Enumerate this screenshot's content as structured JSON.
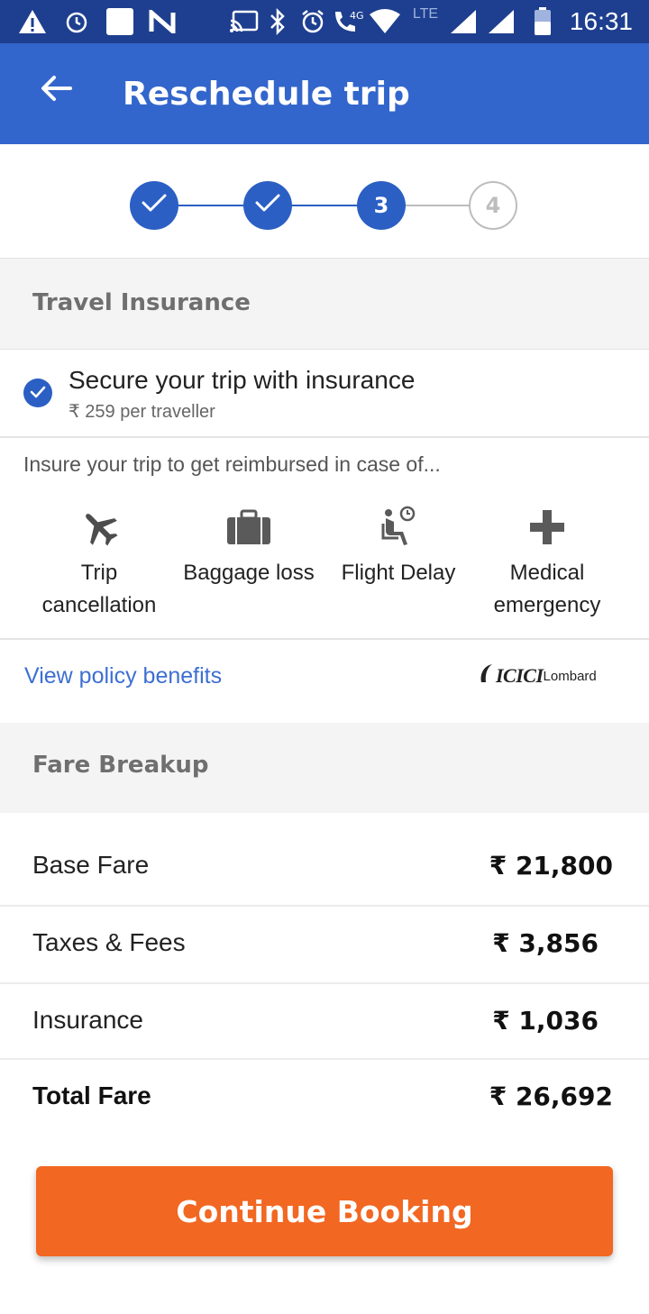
{
  "status_bar": {
    "time": "16:31",
    "network_label": "LTE",
    "data_label": "4G",
    "icons": [
      "alert-icon",
      "alarm-icon",
      "notification-icon",
      "n-icon",
      "cast-icon",
      "bluetooth-icon",
      "alarm-icon",
      "volte-icon",
      "wifi-icon",
      "signal-icon",
      "signal-icon",
      "battery-icon"
    ]
  },
  "app_bar": {
    "title": "Reschedule trip",
    "back_icon": "arrow-back-icon",
    "color": "#3366cc"
  },
  "stepper": {
    "steps": [
      {
        "label": "",
        "state": "done"
      },
      {
        "label": "",
        "state": "done"
      },
      {
        "label": "3",
        "state": "current"
      },
      {
        "label": "4",
        "state": "todo"
      }
    ]
  },
  "insurance": {
    "section_title": "Travel Insurance",
    "option_title": "Secure your trip with insurance",
    "option_price": "₹ 259 per traveller",
    "checked": true,
    "description": "Insure your trip to get reimbursed in case of...",
    "benefits": [
      {
        "icon": "airplane-icon",
        "line1": "Trip",
        "line2": "cancellation"
      },
      {
        "icon": "briefcase-icon",
        "line1": "Baggage loss",
        "line2": ""
      },
      {
        "icon": "seat-clock-icon",
        "line1": "Flight Delay",
        "line2": ""
      },
      {
        "icon": "medical-cross-icon",
        "line1": "Medical",
        "line2": "emergency"
      }
    ],
    "policy_link": "View policy benefits",
    "provider_logo": {
      "big": "ICICI",
      "small": "Lombard"
    }
  },
  "fare": {
    "section_title": "Fare Breakup",
    "rows": [
      {
        "label": "Base Fare",
        "amount": "₹ 21,800"
      },
      {
        "label": "Taxes & Fees",
        "amount": "₹ 3,856"
      },
      {
        "label": "Insurance",
        "amount": "₹ 1,036"
      }
    ],
    "total": {
      "label": "Total Fare",
      "amount": "₹ 26,692"
    }
  },
  "cta": {
    "label": "Continue Booking",
    "color": "#f26722"
  }
}
